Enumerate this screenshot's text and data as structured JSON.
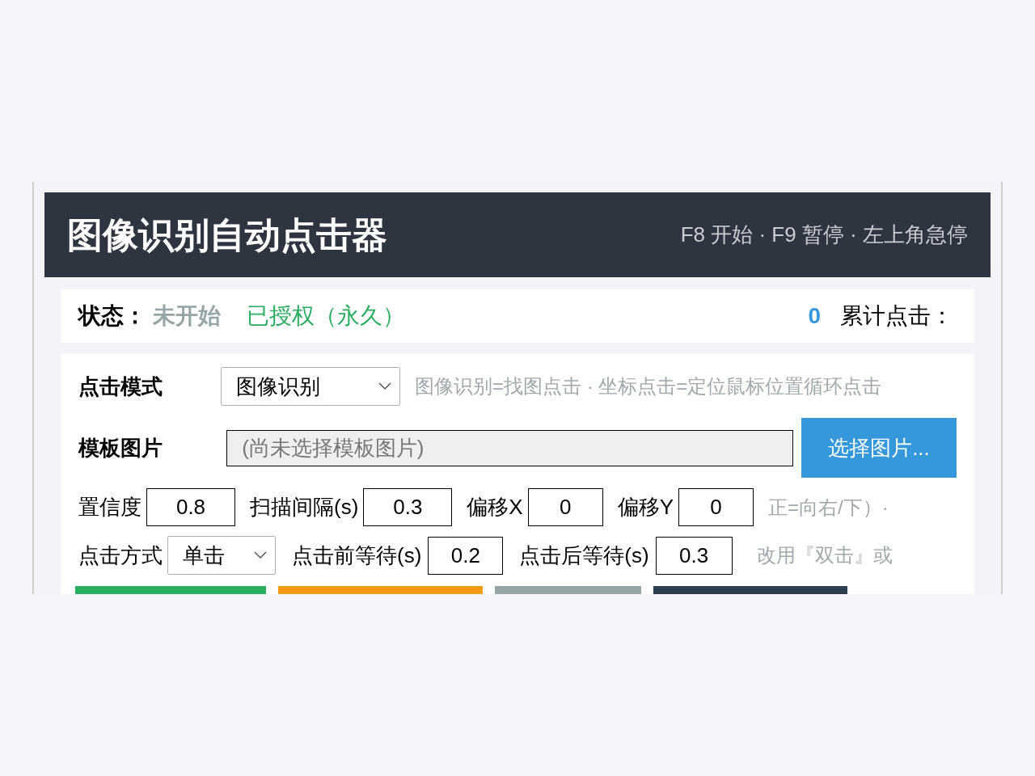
{
  "window": {
    "title": "图像识别自动点击器",
    "hotkeys": "F8 开始 · F9 暂停 · 左上角急停"
  },
  "status": {
    "label": "状态：",
    "value": "未开始",
    "license": "已授权（永久）",
    "count": "0",
    "count_label": "累计点击："
  },
  "mode": {
    "label": "点击模式",
    "value": "图像识别",
    "hint": "图像识别=找图点击 · 坐标点击=定位鼠标位置循环点击"
  },
  "template": {
    "label": "模板图片",
    "value": "(尚未选择模板图片)",
    "button": "选择图片..."
  },
  "params": [
    {
      "label": "置信度",
      "value": "0.8"
    },
    {
      "label": "扫描间隔(s)",
      "value": "0.3"
    },
    {
      "label": "偏移X",
      "value": "0"
    },
    {
      "label": "偏移Y",
      "value": "0"
    }
  ],
  "params_hint": "正=向右/下）·",
  "click": {
    "label": "点击方式",
    "value": "单击",
    "fields": [
      {
        "label": "点击前等待(s)",
        "value": "0.2"
      },
      {
        "label": "点击后等待(s)",
        "value": "0.3"
      }
    ],
    "hint": "改用『双击』或"
  },
  "action_buttons": [
    {
      "color": "#27ae60"
    },
    {
      "color": "#f39c12"
    },
    {
      "color": "#95a5a6"
    },
    {
      "color": "#2c3e50"
    }
  ]
}
